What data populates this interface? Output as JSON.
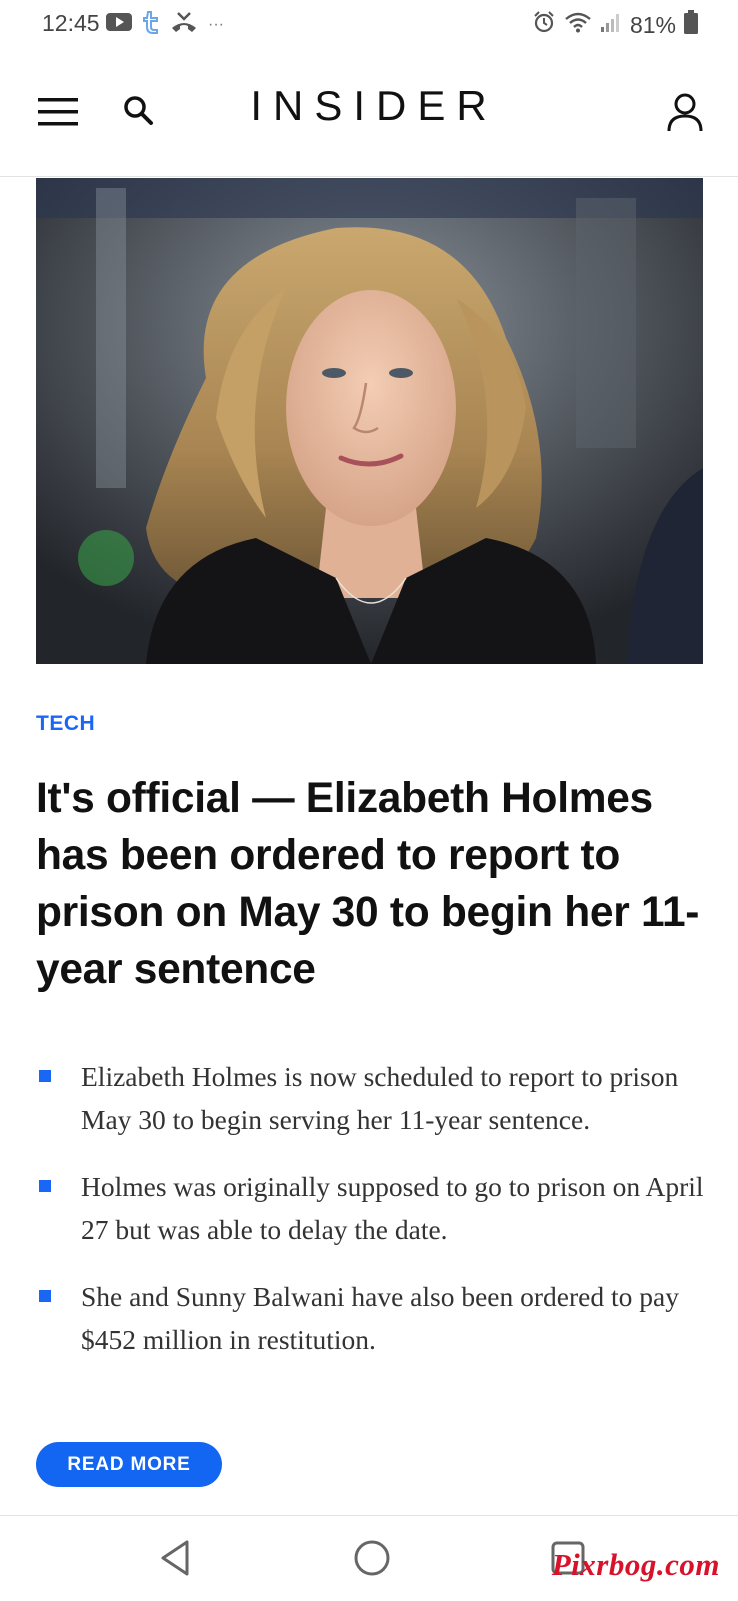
{
  "status_bar": {
    "time": "12:45",
    "battery": "81%",
    "left_icons": [
      "youtube-icon",
      "twitter-app-icon",
      "missed-call-icon",
      "more-dots-icon"
    ],
    "right_icons": [
      "alarm-icon",
      "wifi-icon",
      "signal-icon",
      "battery-icon"
    ],
    "more_dots": "···"
  },
  "header": {
    "logo": "INSIDER",
    "icons": [
      "menu-icon",
      "search-icon",
      "account-icon"
    ]
  },
  "article": {
    "category": "TECH",
    "headline": "It's official — Elizabeth Holmes has been ordered to report to prison on May 30 to begin her 11-year sentence",
    "bullets": [
      "Elizabeth Holmes is now scheduled to report to prison May 30 to begin serving her 11-year sentence.",
      "Holmes was originally supposed to go to prison on April 27 but was able to delay the date.",
      "She and Sunny Balwani have also been ordered to pay $452 million in restitution."
    ],
    "read_more": "READ MORE"
  },
  "nav_bar": {
    "icons": [
      "back-icon",
      "home-icon",
      "recents-icon"
    ]
  },
  "watermark": "Pixrbog.com",
  "colors": {
    "accent": "#1a66f5",
    "button": "#1266f1",
    "watermark": "#d9122b"
  }
}
